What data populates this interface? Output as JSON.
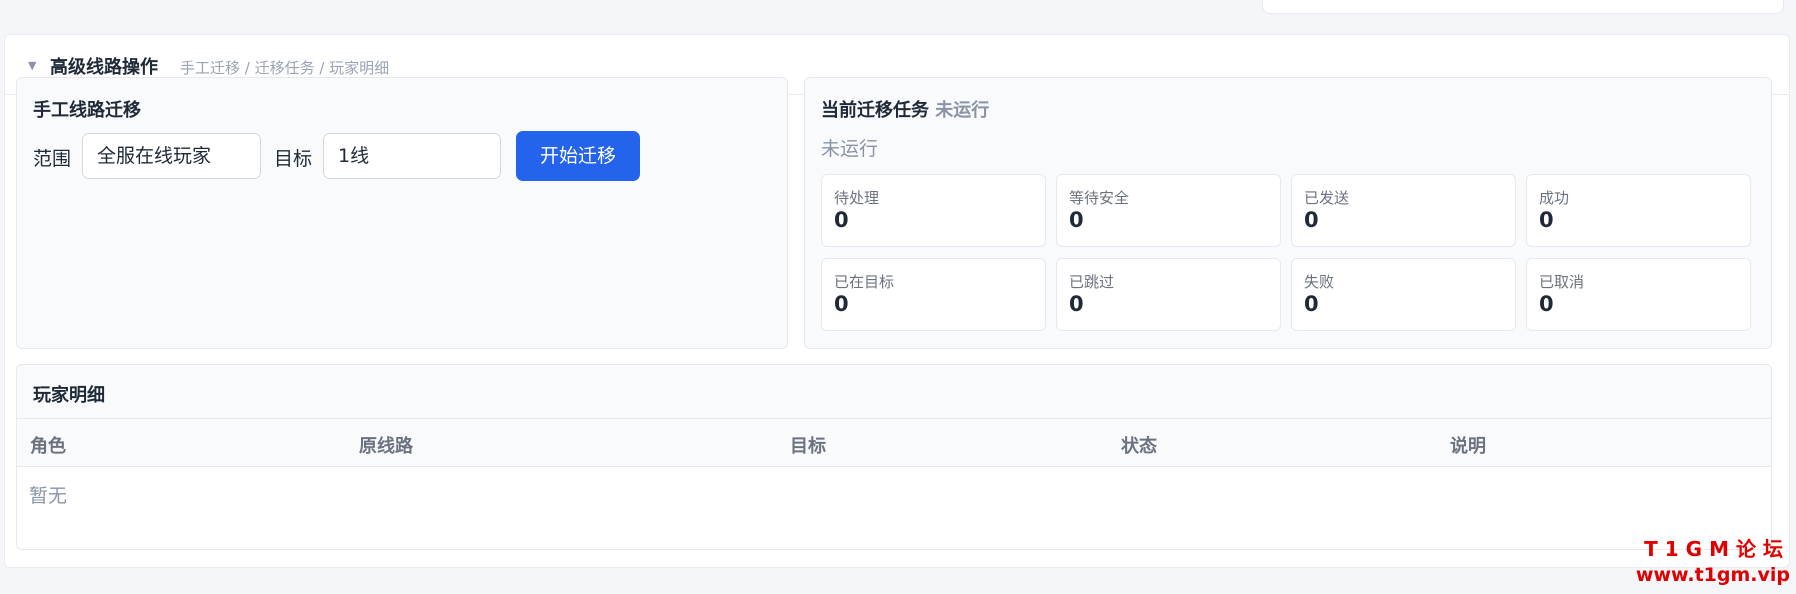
{
  "section": {
    "caret_icon": "triangle-down-icon",
    "title": "高级线路操作",
    "subtitle": "手工迁移 / 迁移任务 / 玩家明细"
  },
  "manual": {
    "title": "手工线路迁移",
    "scope_label": "范围",
    "scope_value": "全服在线玩家",
    "target_label": "目标",
    "target_value": "1线",
    "start_button": "开始迁移",
    "button_color": "#2463eb"
  },
  "task": {
    "title": "当前迁移任务",
    "title_status": "未运行",
    "status_text": "未运行",
    "stats": [
      {
        "label": "待处理",
        "value": "0"
      },
      {
        "label": "等待安全",
        "value": "0"
      },
      {
        "label": "已发送",
        "value": "0"
      },
      {
        "label": "成功",
        "value": "0"
      },
      {
        "label": "已在目标",
        "value": "0"
      },
      {
        "label": "已跳过",
        "value": "0"
      },
      {
        "label": "失败",
        "value": "0"
      },
      {
        "label": "已取消",
        "value": "0"
      }
    ]
  },
  "players": {
    "title": "玩家明细",
    "columns": [
      "角色",
      "原线路",
      "目标",
      "状态",
      "说明"
    ],
    "empty_text": "暂无"
  },
  "watermark": {
    "line1": "T1GM论坛",
    "line2": "www.t1gm.vip",
    "color": "#e00000"
  }
}
